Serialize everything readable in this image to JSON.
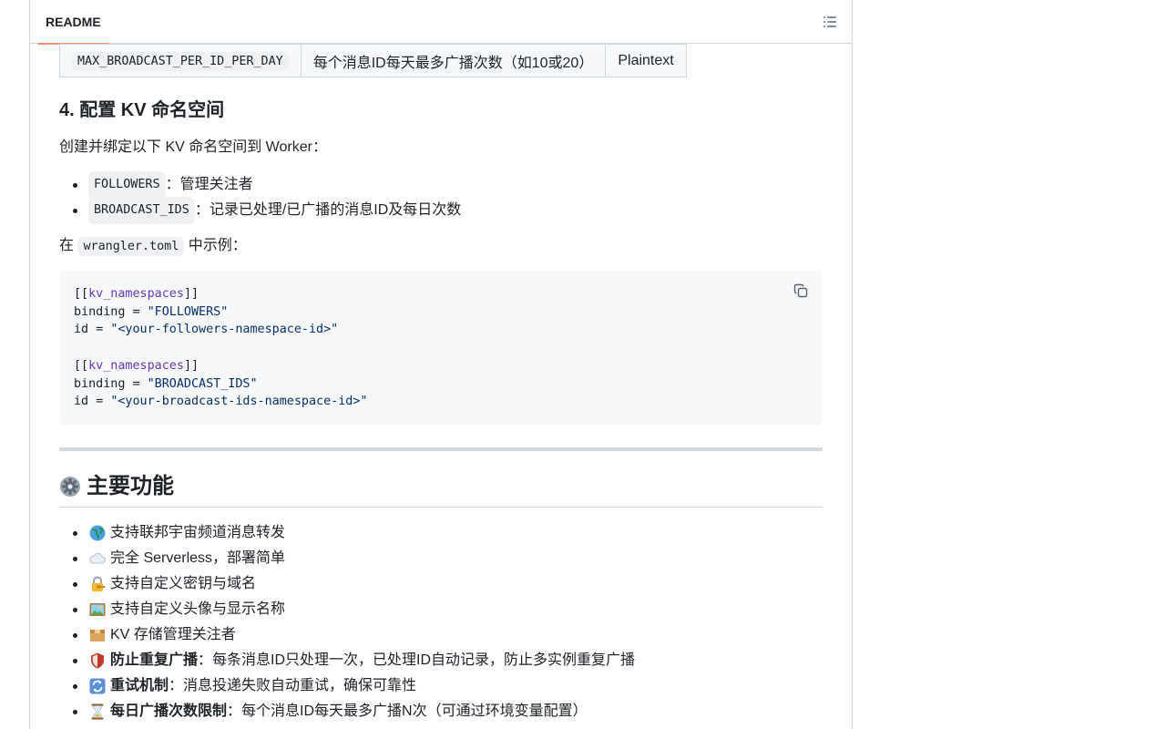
{
  "header": {
    "tab_label": "README",
    "outline_icon": "list-unordered-icon"
  },
  "env_table": {
    "row": {
      "name": "MAX_BROADCAST_PER_ID_PER_DAY",
      "description": "每个消息ID每天最多广播次数（如10或20）",
      "type": "Plaintext"
    }
  },
  "kv_section": {
    "heading": "4. 配置 KV 命名空间",
    "intro": "创建并绑定以下 KV 命名空间到 Worker：",
    "items": [
      {
        "code": "FOLLOWERS",
        "text": "：管理关注者"
      },
      {
        "code": "BROADCAST_IDS",
        "text": "：记录已处理/已广播的消息ID及每日次数"
      }
    ],
    "example_prefix": "在",
    "example_code": "wrangler.toml",
    "example_suffix": "中示例："
  },
  "code_block": {
    "lines": [
      {
        "a": "[[",
        "key": "kv_namespaces",
        "b": "]]"
      },
      {
        "a": "binding = ",
        "str": "\"FOLLOWERS\""
      },
      {
        "a": "id = ",
        "str": "\"<your-followers-namespace-id>\""
      },
      {
        "a": ""
      },
      {
        "a": "[[",
        "key": "kv_namespaces",
        "b": "]]"
      },
      {
        "a": "binding = ",
        "str": "\"BROADCAST_IDS\""
      },
      {
        "a": "id = ",
        "str": "\"<your-broadcast-ids-namespace-id>\""
      }
    ],
    "copy_icon": "copy-icon"
  },
  "features": {
    "heading": "主要功能",
    "heading_icon": "gear-icon",
    "items": [
      {
        "icon": "globe-icon",
        "bold": "",
        "text": "支持联邦宇宙频道消息转发"
      },
      {
        "icon": "cloud-icon",
        "bold": "",
        "text": "完全 Serverless，部署简单"
      },
      {
        "icon": "lock-key-icon",
        "bold": "",
        "text": "支持自定义密钥与域名"
      },
      {
        "icon": "picture-icon",
        "bold": "",
        "text": "支持自定义头像与显示名称"
      },
      {
        "icon": "box-icon",
        "bold": "",
        "text": "KV 存储管理关注者"
      },
      {
        "icon": "shield-icon",
        "bold": "防止重复广播",
        "text": "：每条消息ID只处理一次，已处理ID自动记录，防止多实例重复广播"
      },
      {
        "icon": "retry-icon",
        "bold": "重试机制",
        "text": "：消息投递失败自动重试，确保可靠性"
      },
      {
        "icon": "hourglass-icon",
        "bold": "每日广播次数限制",
        "text": "：每个消息ID每天最多广播N次（可通过环境变量配置）"
      }
    ]
  }
}
